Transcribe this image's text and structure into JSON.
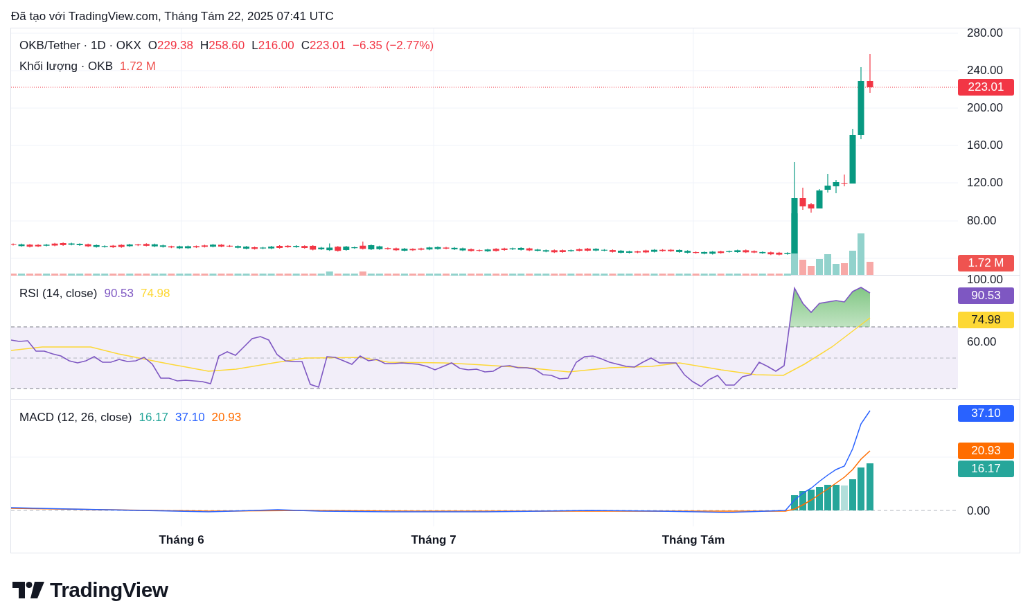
{
  "caption": "Đã tạo với TradingView.com, Tháng Tám 22, 2025 07:41 UTC",
  "main_pane": {
    "legend": {
      "symbol": "OKB/Tether · 1D · OKX",
      "ohlc": [
        {
          "label": "O",
          "value": "229.38"
        },
        {
          "label": "H",
          "value": "258.60"
        },
        {
          "label": "L",
          "value": "216.00"
        },
        {
          "label": "C",
          "value": "223.01"
        }
      ],
      "change": "−6.35 (−2.77%)"
    },
    "volume_legend": {
      "label": "Khối lượng · OKB",
      "value": "1.72 M"
    },
    "axis": [
      "280.00",
      "240.00",
      "200.00",
      "160.00",
      "120.00",
      "80.00"
    ],
    "tags": [
      {
        "text": "223.01",
        "color": "#f23645"
      },
      {
        "text": "1.72 M",
        "color": "#ef5350"
      }
    ]
  },
  "rsi_pane": {
    "title": "RSI (14, close)",
    "values": [
      {
        "text": "90.53",
        "color": "#7e57c2"
      },
      {
        "text": "74.98",
        "color": "#fdd835"
      }
    ],
    "axis": [
      "100.00",
      "60.00"
    ],
    "tags": [
      {
        "text": "90.53",
        "color": "#7e57c2"
      },
      {
        "text": "74.98",
        "color": "#fdd835"
      }
    ]
  },
  "macd_pane": {
    "title": "MACD (12, 26, close)",
    "values": [
      {
        "text": "16.17",
        "color": "#26a69a"
      },
      {
        "text": "37.10",
        "color": "#2962ff"
      },
      {
        "text": "20.93",
        "color": "#ff6d00"
      }
    ],
    "axis": [
      "0.00"
    ],
    "tags": [
      {
        "text": "37.10",
        "color": "#2962ff"
      },
      {
        "text": "20.93",
        "color": "#ff6d00"
      },
      {
        "text": "16.17",
        "color": "#26a69a"
      }
    ]
  },
  "time_axis": [
    "Tháng 6",
    "Tháng 7",
    "Tháng Tám"
  ],
  "logo": "TradingView"
}
